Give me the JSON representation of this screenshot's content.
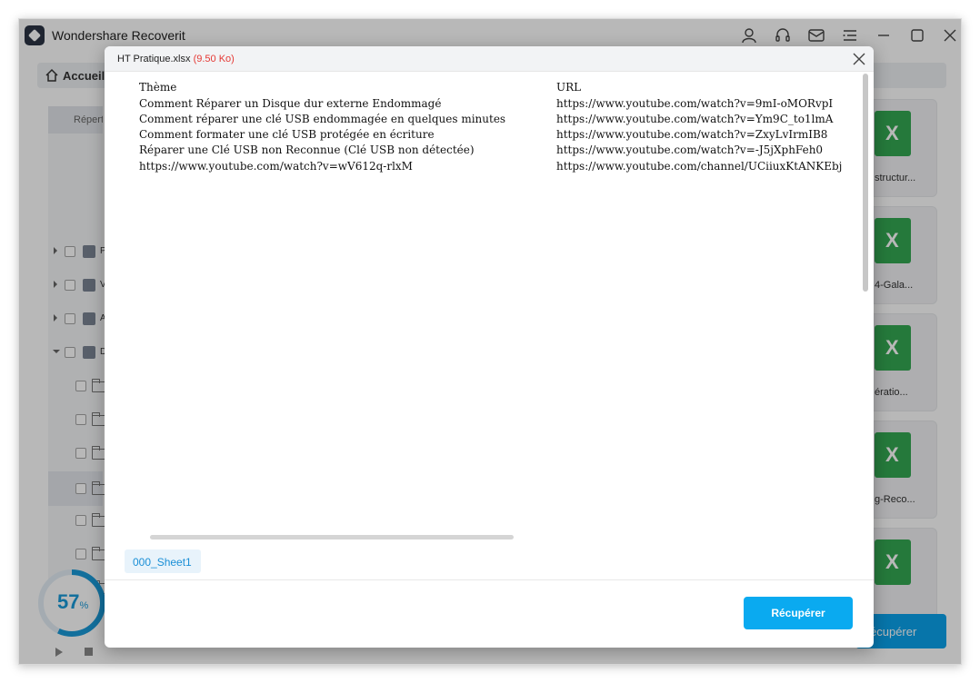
{
  "app": {
    "title": "Wondershare Recoverit"
  },
  "nav": {
    "home_label": "Accueil"
  },
  "sidebar": {
    "header": "Répertoire",
    "categories": [
      "P",
      "V",
      "A",
      "D"
    ]
  },
  "cards": [
    "structur...",
    "4-Gala...",
    "ératio...",
    "g-Reco...",
    ""
  ],
  "background_recover_label": "écupérer",
  "progress": {
    "value": "57",
    "unit": "%"
  },
  "dialog": {
    "filename": "HT Pratique.xlsx",
    "filesize": "(9.50 Ko)",
    "sheet_tab": "000_Sheet1",
    "recover_label": "Récupérer",
    "rows": [
      [
        "Thème",
        "URL"
      ],
      [
        "Comment Réparer un Disque dur externe Endommagé",
        "https://www.youtube.com/watch?v=9mI-oMORvpI"
      ],
      [
        "Comment réparer une clé USB endommagée en quelques minutes",
        "https://www.youtube.com/watch?v=Ym9C_to1lmA"
      ],
      [
        "Comment formater une clé USB protégée en écriture",
        "https://www.youtube.com/watch?v=ZxyLvIrmIB8"
      ],
      [
        "Réparer une Clé USB non Reconnue (Clé USB non détectée)",
        "https://www.youtube.com/watch?v=-J5jXphFeh0"
      ],
      [
        "https://www.youtube.com/watch?v=wV612q-rlxM",
        "https://www.youtube.com/channel/UCiiuxKtANKEbj"
      ]
    ]
  },
  "colors": {
    "accent": "#0aaaf0",
    "filesize": "#e53935",
    "progress": "#1a9ad8"
  }
}
